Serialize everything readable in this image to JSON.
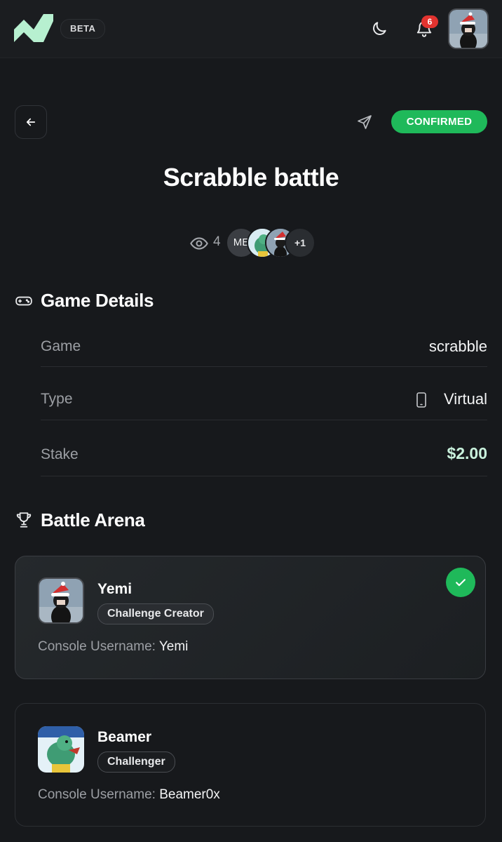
{
  "header": {
    "beta_label": "BETA",
    "notification_count": "6"
  },
  "status": {
    "label": "CONFIRMED",
    "color": "#1fb95a"
  },
  "challenge": {
    "title": "Scrabble battle",
    "viewer_count": "4",
    "viewers": [
      {
        "label": "ME"
      },
      {
        "icon": "dinosaur-avatar"
      },
      {
        "icon": "santa-hat-avatar"
      },
      {
        "label": "+1"
      }
    ]
  },
  "game_details": {
    "heading": "Game Details",
    "rows": [
      {
        "label": "Game",
        "value": "scrabble"
      },
      {
        "label": "Type",
        "value": "Virtual",
        "icon": "phone-icon"
      },
      {
        "label": "Stake",
        "value": "$2.00"
      }
    ]
  },
  "battle_arena": {
    "heading": "Battle Arena",
    "console_label": "Console Username:",
    "players": [
      {
        "name": "Yemi",
        "role": "Challenge Creator",
        "console_username": "Yemi",
        "confirmed": true
      },
      {
        "name": "Beamer",
        "role": "Challenger",
        "console_username": "Beamer0x",
        "confirmed": false
      }
    ]
  },
  "icons": [
    "logo-icon",
    "moon-icon",
    "bell-icon",
    "back-arrow-icon",
    "send-icon",
    "eye-icon",
    "gamepad-icon",
    "trophy-icon",
    "check-icon"
  ],
  "colors": {
    "accent_green": "#1fb95a",
    "badge_red": "#e2332f",
    "stake_green": "#c9f2dd"
  }
}
